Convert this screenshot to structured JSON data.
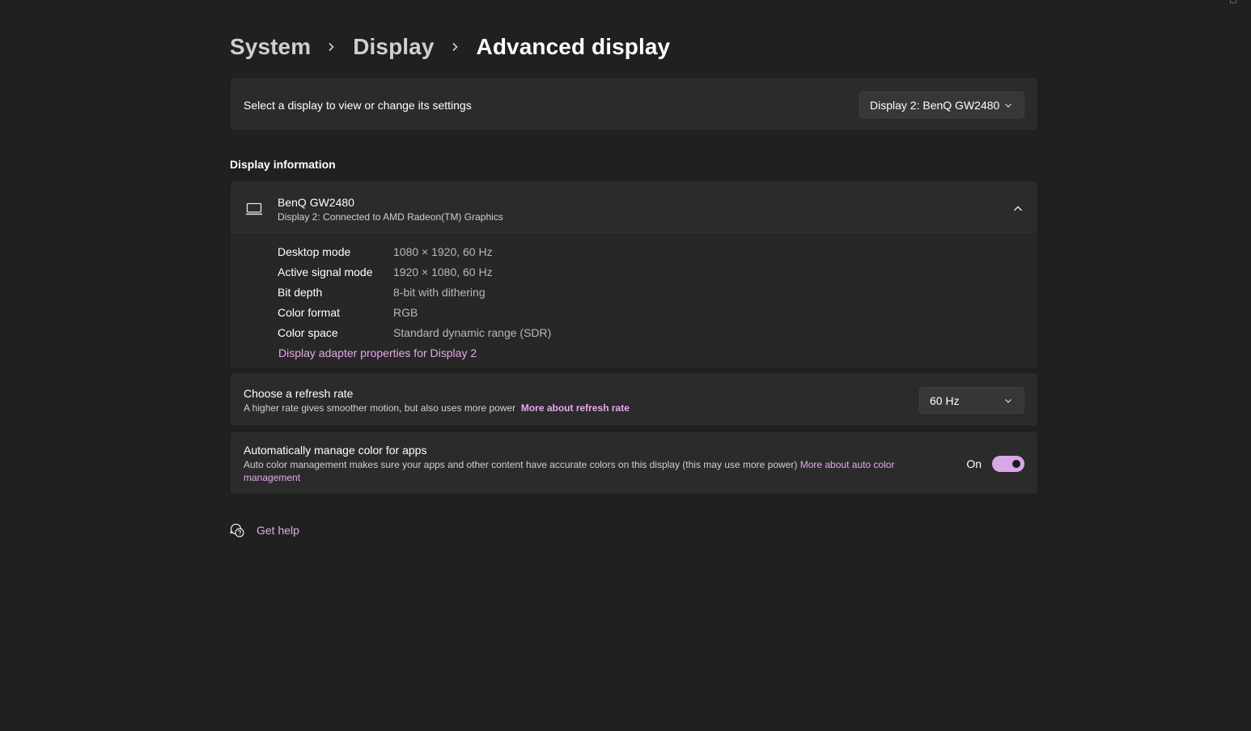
{
  "breadcrumb": {
    "items": [
      "System",
      "Display",
      "Advanced display"
    ]
  },
  "display_select": {
    "label": "Select a display to view or change its settings",
    "selected": "Display 2: BenQ GW2480"
  },
  "display_info": {
    "section_title": "Display information",
    "name": "BenQ GW2480",
    "subtitle": "Display 2: Connected to AMD Radeon(TM) Graphics",
    "rows": [
      {
        "label": "Desktop mode",
        "value": "1080 × 1920, 60 Hz"
      },
      {
        "label": "Active signal mode",
        "value": "1920 × 1080, 60 Hz"
      },
      {
        "label": "Bit depth",
        "value": "8-bit with dithering"
      },
      {
        "label": "Color format",
        "value": "RGB"
      },
      {
        "label": "Color space",
        "value": "Standard dynamic range (SDR)"
      }
    ],
    "adapter_link": "Display adapter properties for Display 2"
  },
  "refresh_rate": {
    "title": "Choose a refresh rate",
    "description": "A higher rate gives smoother motion, but also uses more power",
    "link": "More about refresh rate",
    "selected": "60 Hz"
  },
  "color_management": {
    "title": "Automatically manage color for apps",
    "description": "Auto color management makes sure your apps and other content have accurate colors on this display (this may use more power)",
    "link": "More about auto color management",
    "toggle_label": "On",
    "toggle_on": true
  },
  "help": {
    "label": "Get help"
  },
  "icons": {
    "monitor": "monitor-icon",
    "help": "help-chat-icon",
    "chevron_up": "chevron-up-icon",
    "chevron_down": "chevron-down-icon",
    "chevron_right": "chevron-right-icon"
  },
  "colors": {
    "background": "#202020",
    "card": "#2b2b2b",
    "accent": "#e5a9ec",
    "toggle_on": "#d9a7e6"
  }
}
